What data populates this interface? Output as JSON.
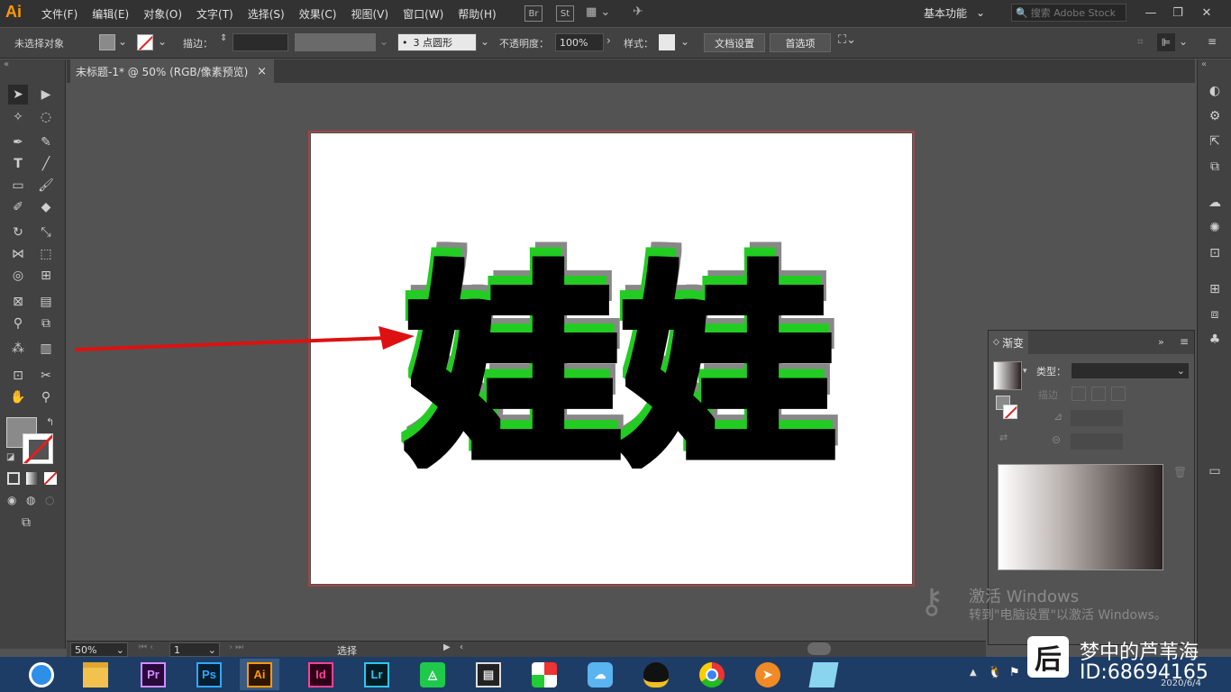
{
  "menubar": {
    "logo": "Ai",
    "items": [
      "文件(F)",
      "编辑(E)",
      "对象(O)",
      "文字(T)",
      "选择(S)",
      "效果(C)",
      "视图(V)",
      "窗口(W)",
      "帮助(H)"
    ],
    "bridge_label": "Br",
    "stock_label": "St",
    "workspace": "基本功能",
    "search_placeholder": "搜索 Adobe Stock"
  },
  "controlbar": {
    "selection": "未选择对象",
    "stroke_label": "描边：",
    "brush": "3 点圆形",
    "opacity_label": "不透明度：",
    "opacity_value": "100%",
    "style_label": "样式：",
    "doc_setup": "文档设置",
    "preferences": "首选项"
  },
  "document": {
    "tab_title": "未标题-1* @ 50% (RGB/像素预览)",
    "close": "×",
    "artwork_text": "娃娃"
  },
  "gradient_panel": {
    "title": "渐变",
    "type_label": "类型：",
    "stroke_label": "描边"
  },
  "statusbar": {
    "zoom": "50%",
    "page": "1",
    "tool": "选择"
  },
  "watermark": {
    "line1": "激活 Windows",
    "line2": "转到\"电脑设置\"以激活 Windows。"
  },
  "taskbar": {
    "apps": [
      "Pr",
      "Ps",
      "Ai",
      "Id",
      "Lr"
    ],
    "date": "2020/6/4",
    "brand_name": "梦中的芦苇海",
    "brand_id": "ID:68694165",
    "brand_logo": "后"
  },
  "colors": {
    "artwork_fill": "#000000",
    "artwork_glow": "#22cc22",
    "arrow": "#dd1111",
    "ai_brand": "#ff9a00"
  }
}
